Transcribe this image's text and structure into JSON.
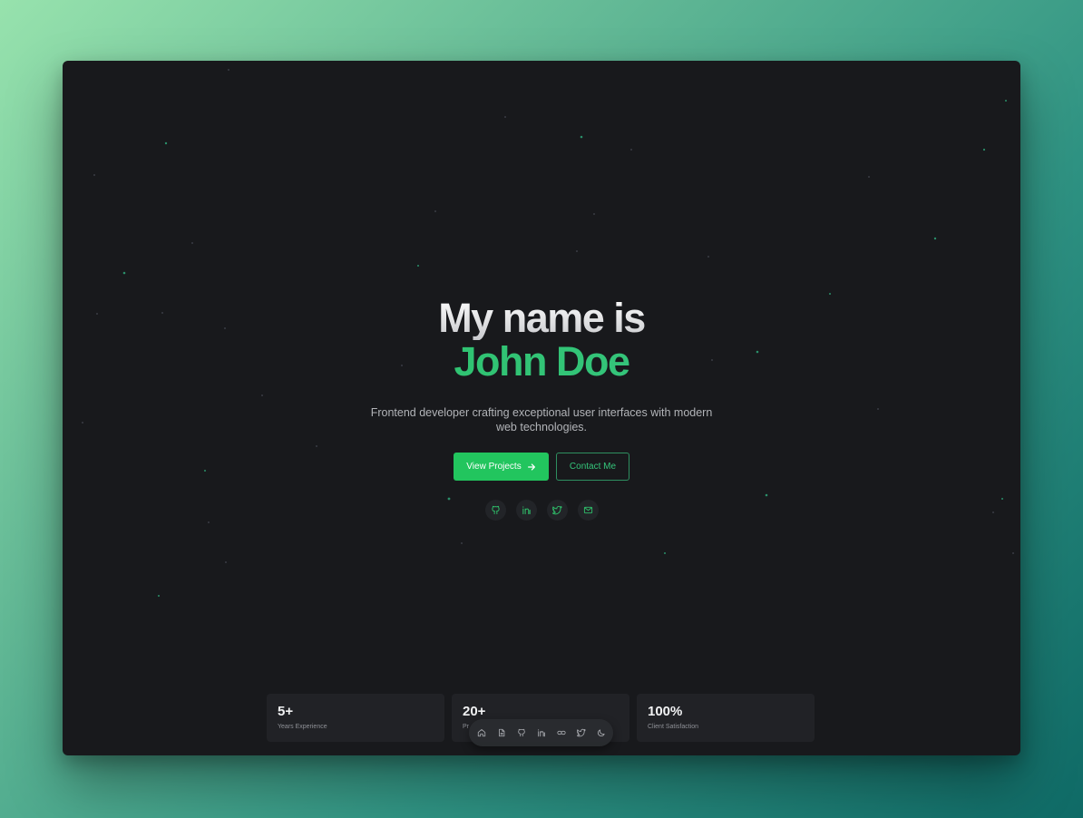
{
  "colors": {
    "accent": "#22c55e",
    "window_bg": "#18191c",
    "card_bg": "#212226"
  },
  "hero": {
    "title_line1": "My name is",
    "title_line2": "John Doe",
    "subtitle": "Frontend developer crafting exceptional user interfaces with modern web technologies."
  },
  "cta": {
    "primary_label": "View Projects",
    "primary_icon": "arrow-right-icon",
    "secondary_label": "Contact Me"
  },
  "social_links": [
    {
      "icon": "github-icon"
    },
    {
      "icon": "linkedin-icon"
    },
    {
      "icon": "twitter-icon"
    },
    {
      "icon": "mail-icon"
    }
  ],
  "stats": [
    {
      "value": "5+",
      "label": "Years Experience"
    },
    {
      "value": "20+",
      "label": "Pr"
    },
    {
      "value": "100%",
      "label": "Client Satisfaction"
    }
  ],
  "dock": [
    {
      "icon": "home-icon"
    },
    {
      "icon": "document-icon"
    },
    {
      "icon": "github-icon"
    },
    {
      "icon": "linkedin-icon"
    },
    {
      "icon": "link-icon"
    },
    {
      "icon": "twitter-icon"
    },
    {
      "icon": "moon-icon"
    }
  ]
}
